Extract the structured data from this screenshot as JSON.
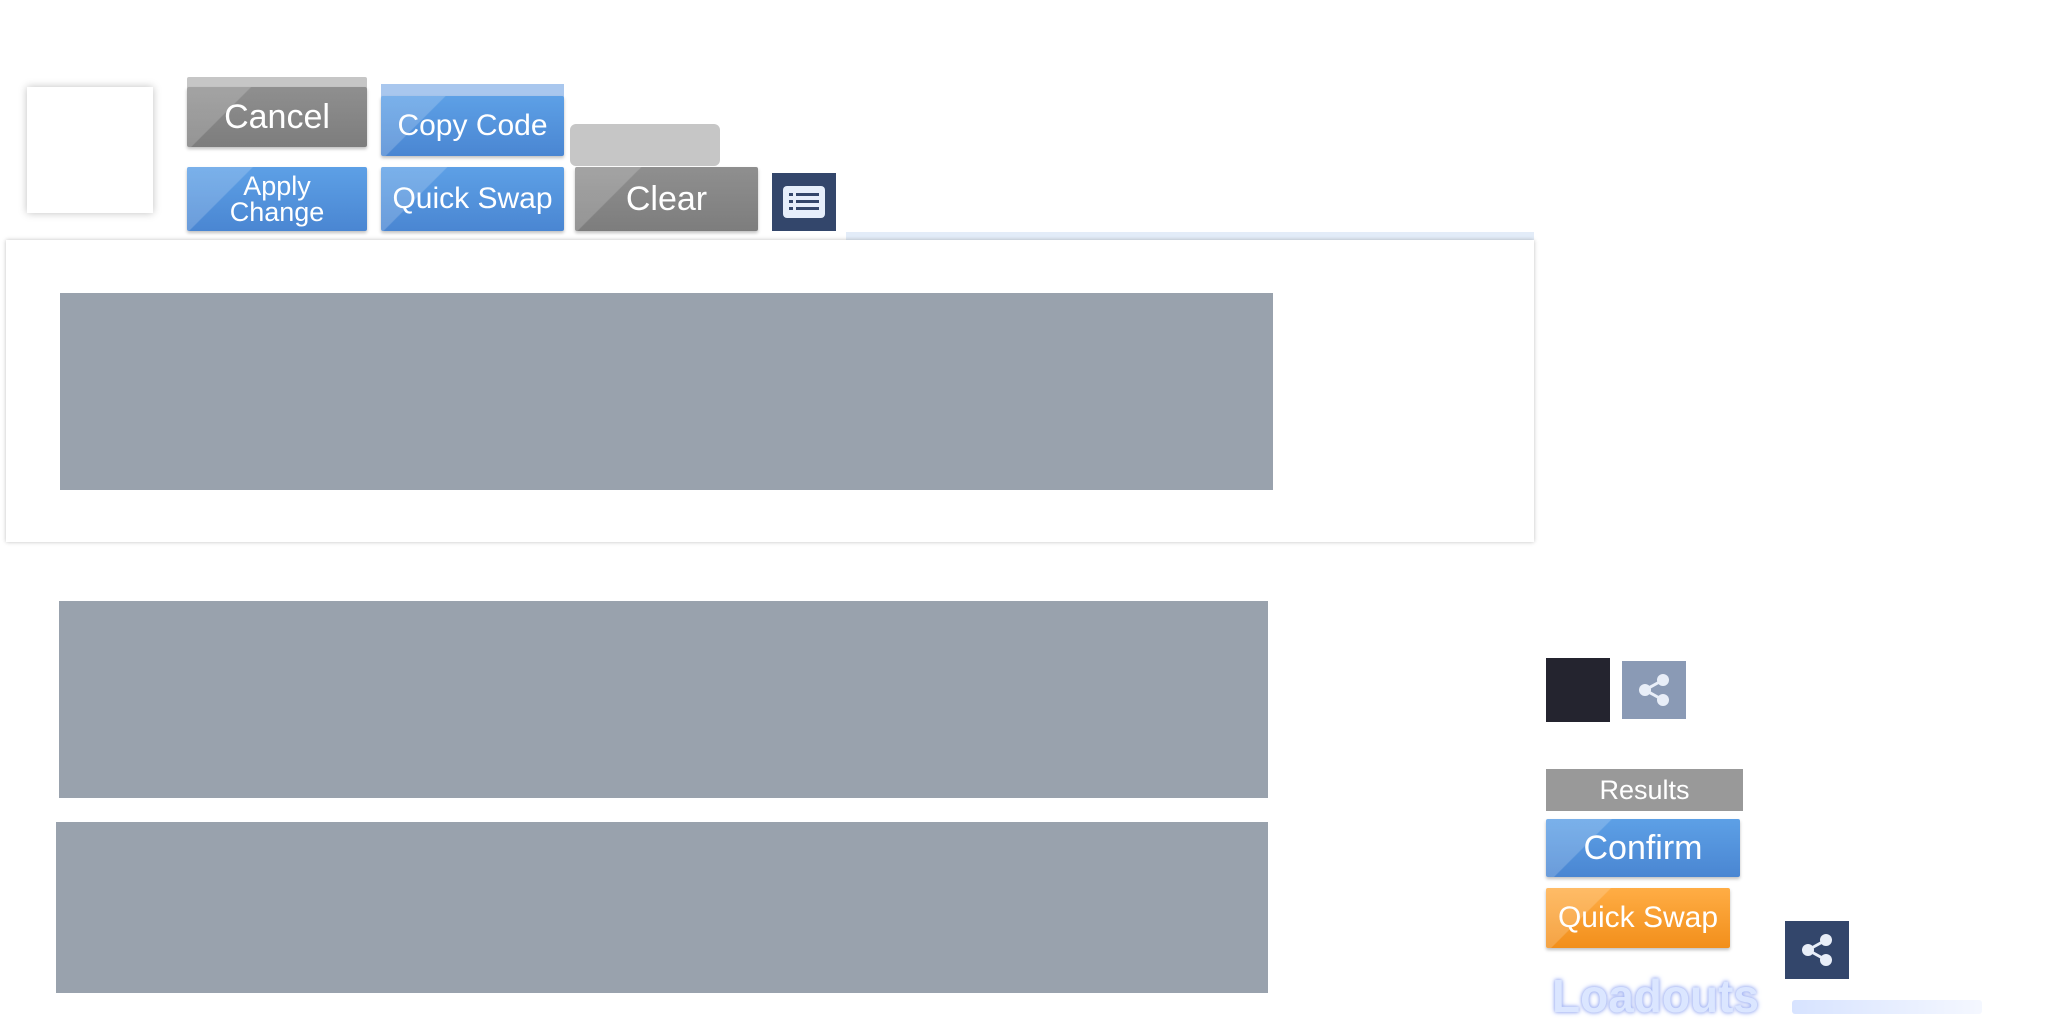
{
  "toolbar": {
    "cancel_label": "Cancel",
    "copy_code_label": "Copy Code",
    "apply_change_line1": "Apply",
    "apply_change_line2": "Change",
    "quick_swap_label": "Quick Swap",
    "clear_label": "Clear",
    "list_icon": "list-icon"
  },
  "side": {
    "share_icon": "share-icon",
    "results_label": "Results",
    "confirm_label": "Confirm",
    "quick_swap_label": "Quick Swap",
    "loadouts_title": "Loadouts"
  },
  "colors": {
    "blue_button": "#4a86d2",
    "gray_button": "#808080",
    "orange_button": "#f5961e",
    "dark_navy": "#33466b",
    "panel_blue": "#8aaed4"
  }
}
